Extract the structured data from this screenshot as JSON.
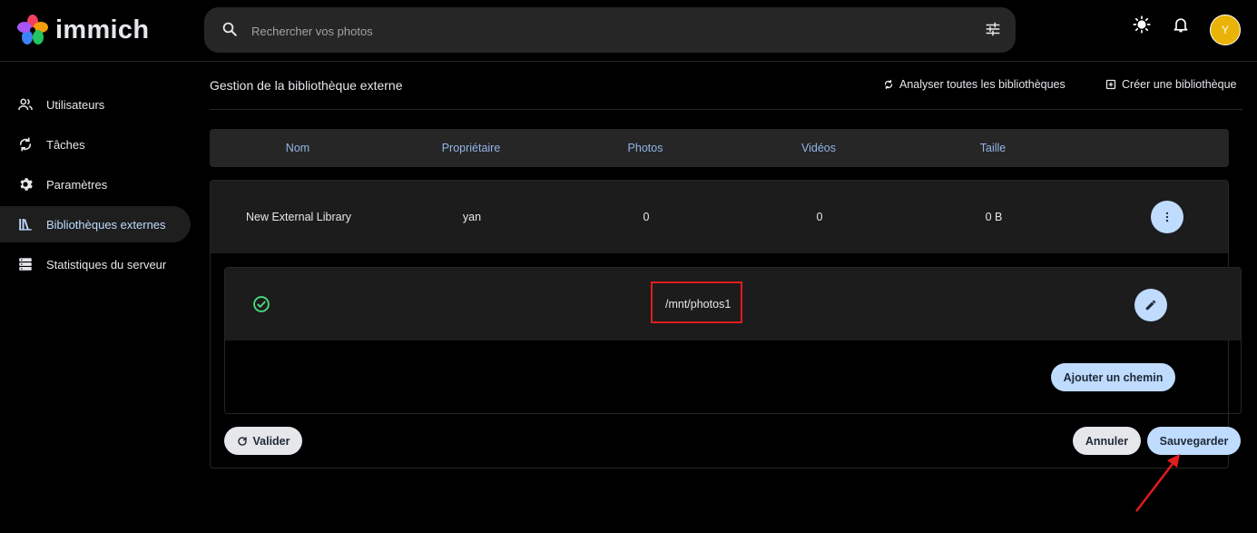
{
  "app": {
    "name": "immich"
  },
  "search": {
    "placeholder": "Rechercher vos photos"
  },
  "user": {
    "initial": "Y",
    "avatar_color": "#eab308"
  },
  "sidebar": {
    "items": [
      {
        "label": "Utilisateurs",
        "icon": "users-icon",
        "active": false
      },
      {
        "label": "Tâches",
        "icon": "sync-icon",
        "active": false
      },
      {
        "label": "Paramètres",
        "icon": "gear-icon",
        "active": false
      },
      {
        "label": "Bibliothèques externes",
        "icon": "library-icon",
        "active": true
      },
      {
        "label": "Statistiques du serveur",
        "icon": "server-icon",
        "active": false
      }
    ]
  },
  "page": {
    "title": "Gestion de la bibliothèque externe",
    "scan_all_label": "Analyser toutes les bibliothèques",
    "create_label": "Créer une bibliothèque"
  },
  "table": {
    "headers": [
      "Nom",
      "Propriétaire",
      "Photos",
      "Vidéos",
      "Taille"
    ],
    "rows": [
      {
        "name": "New External Library",
        "owner": "yan",
        "photos": "0",
        "videos": "0",
        "size": "0 B"
      }
    ]
  },
  "edit_paths": {
    "paths": [
      {
        "path": "/mnt/photos1",
        "valid": true
      }
    ],
    "add_path_label": "Ajouter un chemin",
    "validate_label": "Valider",
    "cancel_label": "Annuler",
    "save_label": "Sauvegarder"
  },
  "colors": {
    "accent": "#bfdbfe",
    "valid": "#4ade80",
    "highlight": "#e11d1d"
  }
}
